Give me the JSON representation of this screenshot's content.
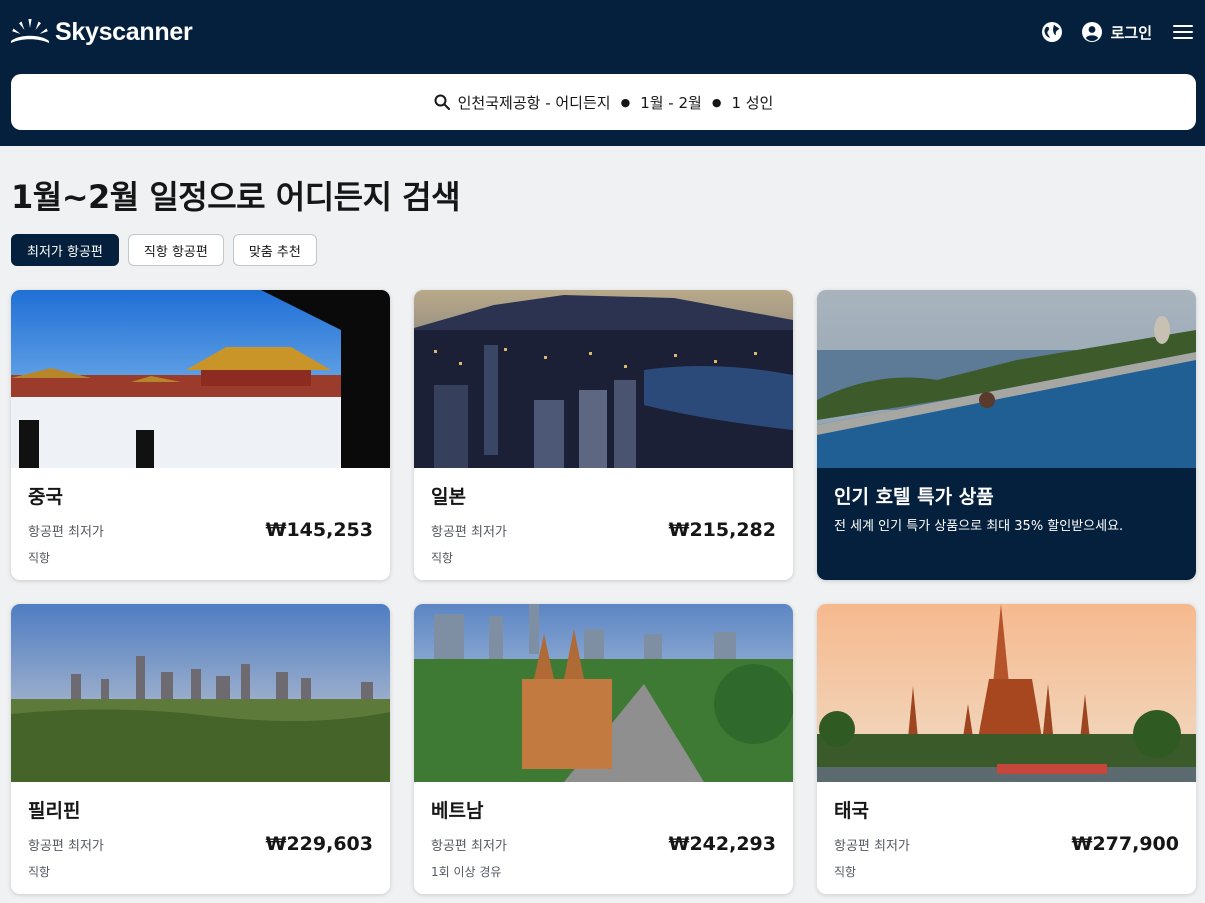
{
  "brand": {
    "name": "Skyscanner"
  },
  "header": {
    "login_label": "로그인"
  },
  "search": {
    "origin": "인천국제공항 - 어디든지",
    "dates": "1월 - 2월",
    "travellers": "1 성인"
  },
  "page": {
    "title": "1월~2월 일정으로 어디든지 검색"
  },
  "tabs": [
    {
      "label": "최저가 항공편"
    },
    {
      "label": "직항 항공편"
    },
    {
      "label": "맞춤 추천"
    }
  ],
  "cards": [
    {
      "name": "중국",
      "sub": "항공편 최저가",
      "price": "₩145,253",
      "stops": "직항"
    },
    {
      "name": "일본",
      "sub": "항공편 최저가",
      "price": "₩215,282",
      "stops": "직항"
    },
    {
      "name": "필리핀",
      "sub": "항공편 최저가",
      "price": "₩229,603",
      "stops": "직항"
    },
    {
      "name": "베트남",
      "sub": "항공편 최저가",
      "price": "₩242,293",
      "stops": "1회 이상 경유"
    },
    {
      "name": "태국",
      "sub": "항공편 최저가",
      "price": "₩277,900",
      "stops": "직항"
    }
  ],
  "hotel_promo": {
    "title": "인기 호텔 특가 상품",
    "description": "전 세계 인기 특가 상품으로 최대 35% 할인받으세요."
  },
  "colors": {
    "header_bg": "#05203c",
    "page_bg": "#eff1f2",
    "active_tab": "#05203c"
  }
}
